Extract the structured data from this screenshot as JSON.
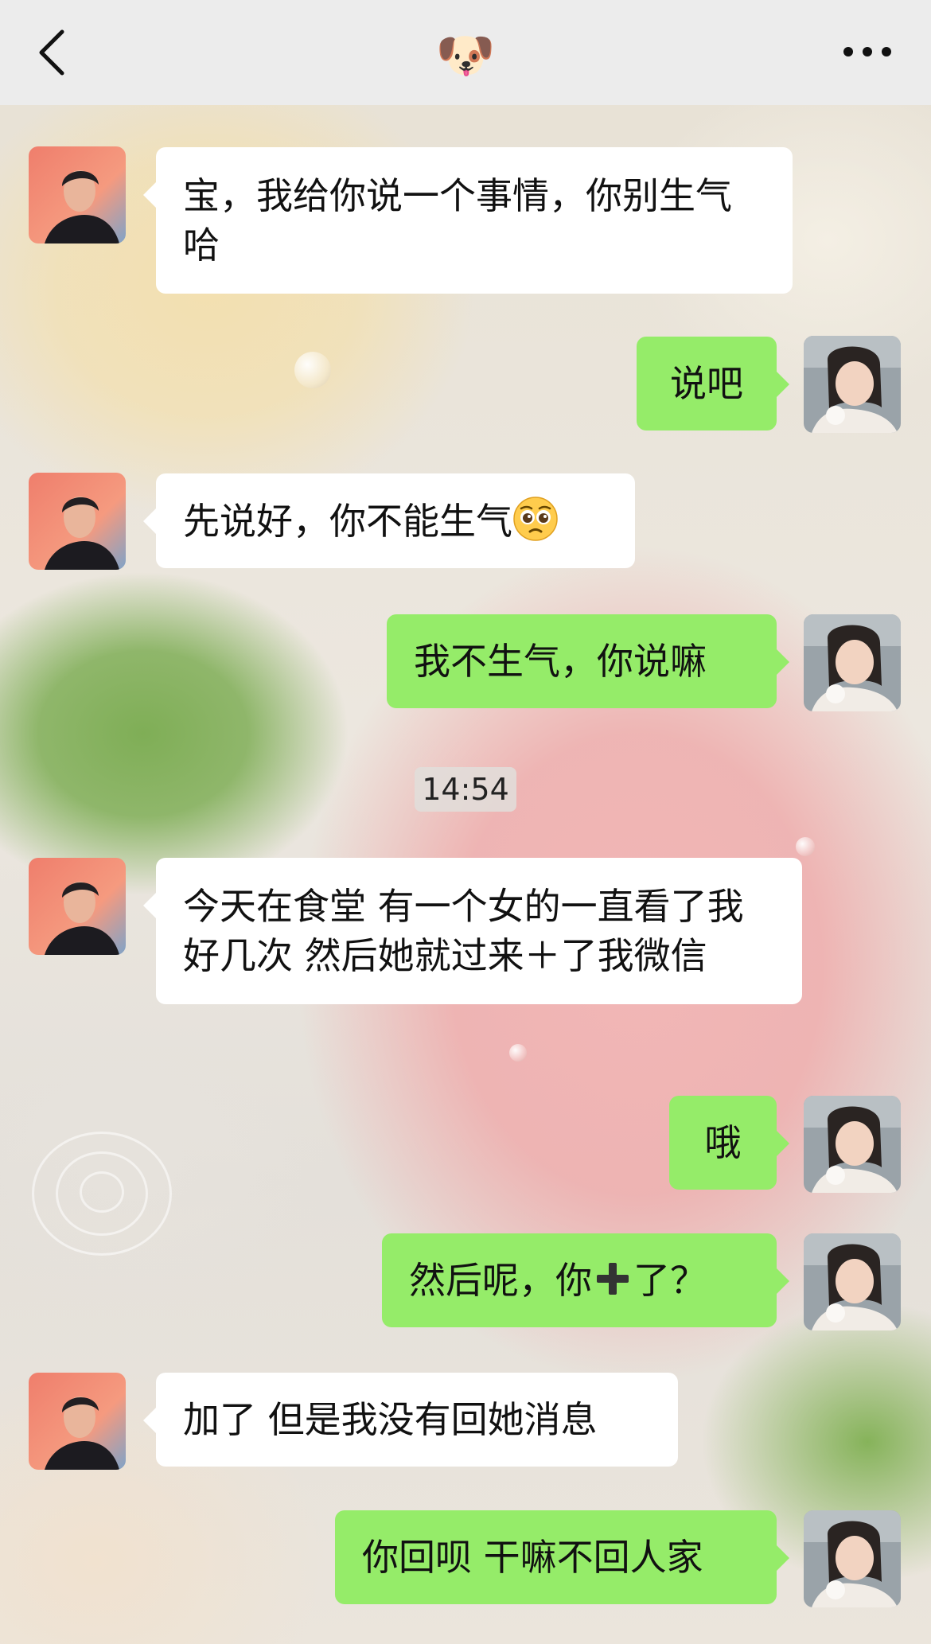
{
  "header": {
    "title_emoji": "🐶"
  },
  "icons": {
    "back": "chevron-left-icon",
    "more": "more-horizontal-icon",
    "title": "dog-face-emoji",
    "inline_emoji": "pleading-face-emoji",
    "plus": "heavy-plus-icon"
  },
  "colors": {
    "incoming_bubble": "#ffffff",
    "outgoing_bubble": "#95ec69",
    "header_bg": "#ececec"
  },
  "messages": [
    {
      "sender": "other",
      "text": "宝，我给你说一个事情，你别生气哈"
    },
    {
      "sender": "me",
      "text": "说吧"
    },
    {
      "sender": "other",
      "text": "先说好，你不能生气",
      "emoji": "🥺"
    },
    {
      "sender": "me",
      "text": "我不生气，你说嘛"
    },
    {
      "sender": "other",
      "text": "今天在食堂 有一个女的一直看了我好几次 然后她就过来＋了我微信"
    },
    {
      "sender": "me",
      "text": "哦"
    },
    {
      "sender": "me",
      "text_before": "然后呢，你",
      "text_after": "了？",
      "glyph": "➕"
    },
    {
      "sender": "other",
      "text": "加了 但是我没有回她消息"
    },
    {
      "sender": "me",
      "text": "你回呗 干嘛不回人家"
    }
  ],
  "timestamp": "14:54"
}
